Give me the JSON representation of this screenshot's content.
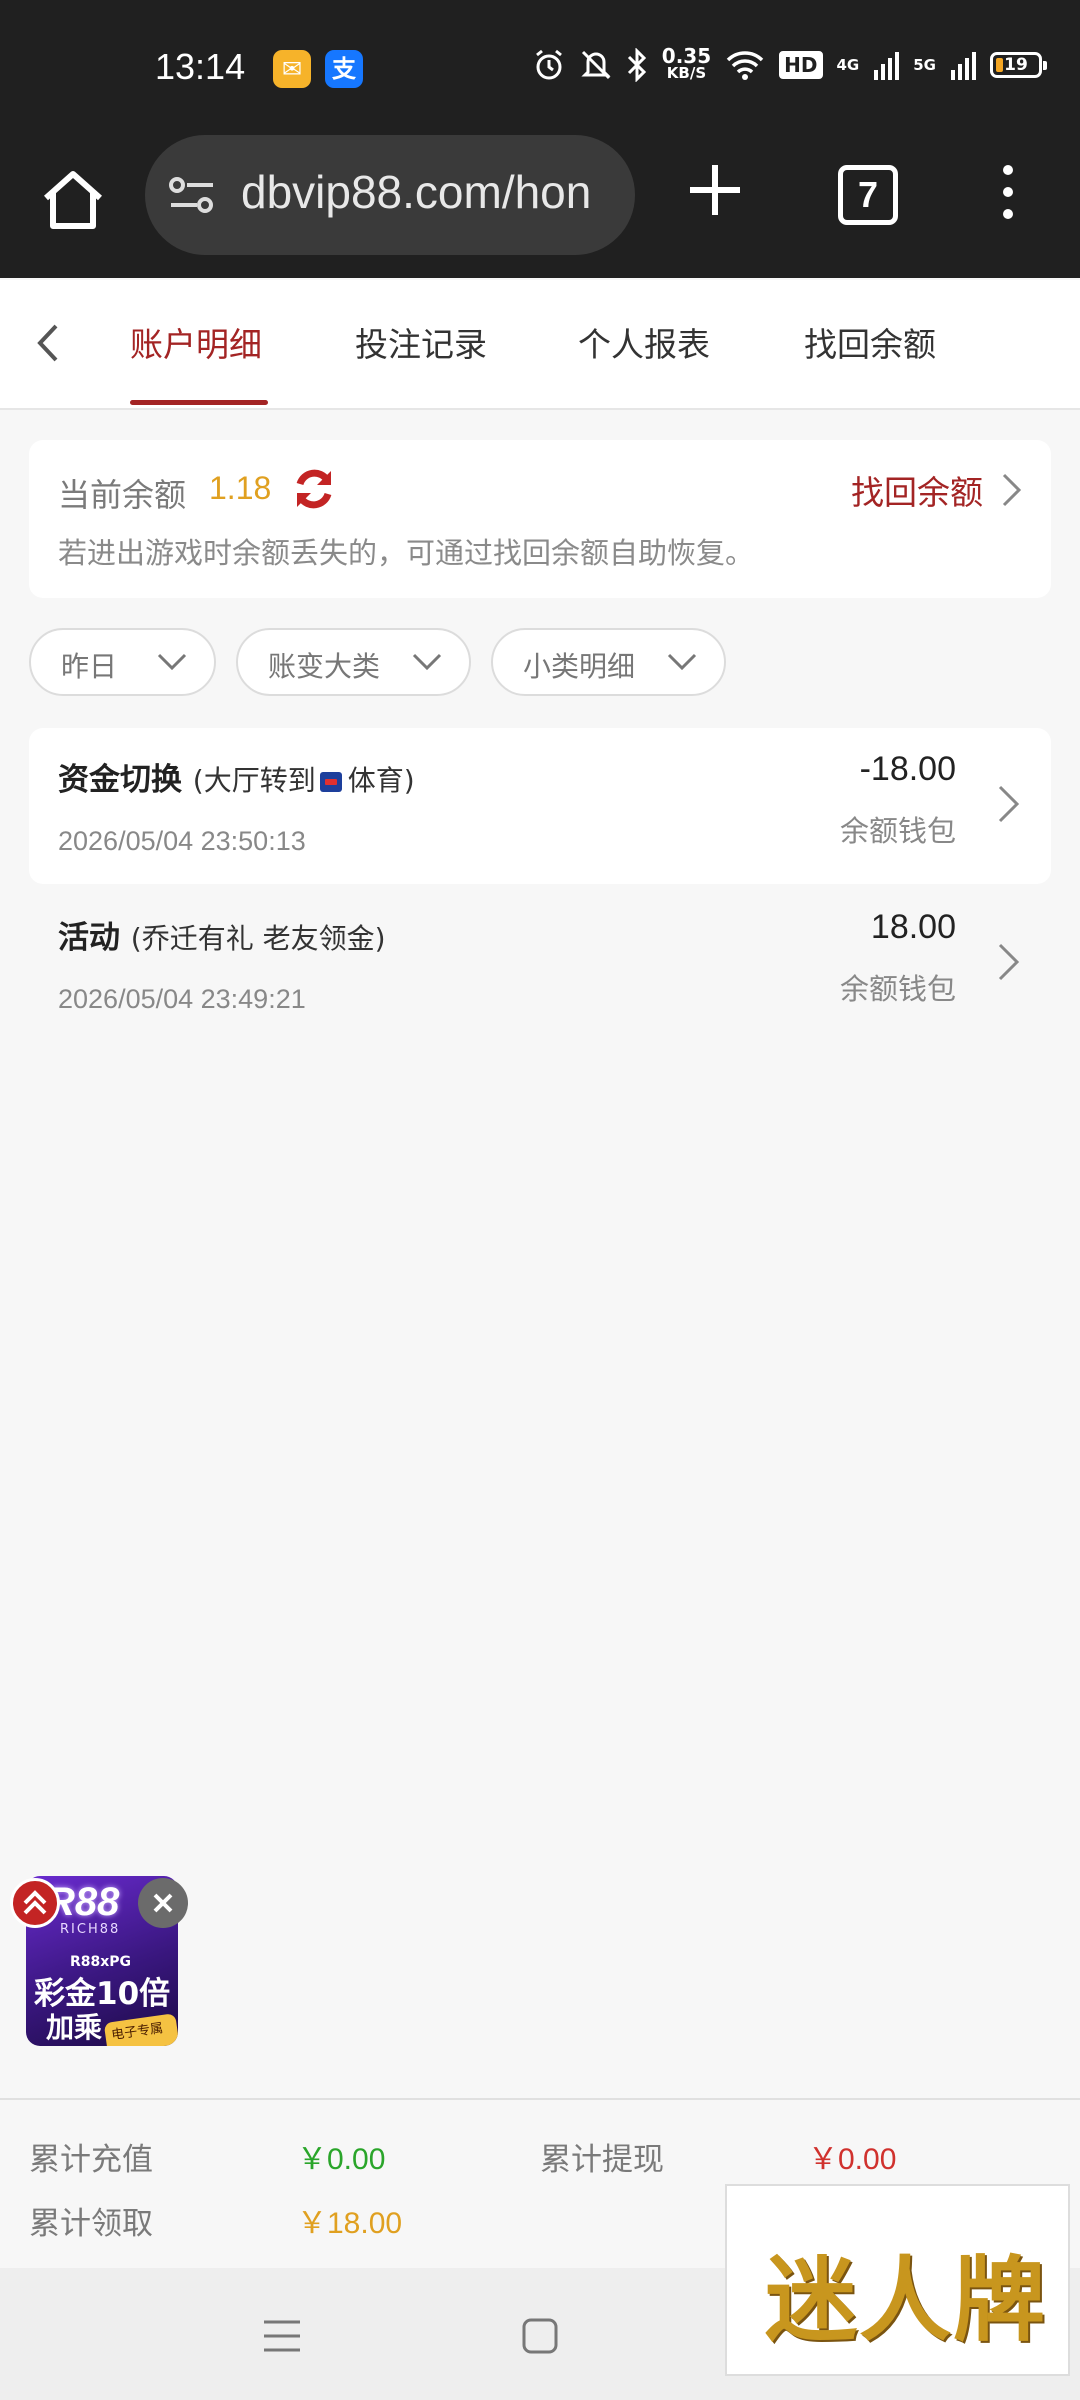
{
  "status_bar": {
    "time": "13:14",
    "net_speed_value": "0.35",
    "net_speed_unit": "KB/S",
    "hd_badge": "HD",
    "net_4g": "4G",
    "net_5g": "5G",
    "battery": "19",
    "app_icons": [
      "mail-app-icon",
      "alipay-app-icon"
    ],
    "icons": [
      "alarm-icon",
      "mute-icon",
      "bluetooth-icon",
      "wifi-icon",
      "signal-icon",
      "battery-icon"
    ]
  },
  "browser": {
    "url": "dbvip88.com/hon",
    "tab_count": "7"
  },
  "tabs": [
    {
      "label": "账户明细",
      "active": true
    },
    {
      "label": "投注记录",
      "active": false
    },
    {
      "label": "个人报表",
      "active": false
    },
    {
      "label": "找回余额",
      "active": false
    }
  ],
  "balance": {
    "label": "当前余额",
    "value": "1.18",
    "recover_label": "找回余额",
    "tip": "若进出游戏时余额丢失的，可通过找回余额自助恢复。"
  },
  "filters": [
    {
      "label": "昨日"
    },
    {
      "label": "账变大类"
    },
    {
      "label": "小类明细"
    }
  ],
  "records": [
    {
      "type": "资金切换",
      "detail_prefix": "(大厅转到",
      "detail_suffix": "体育)",
      "time": "2026/05/04 23:50:13",
      "amount": "-18.00",
      "wallet": "余额钱包"
    },
    {
      "type": "活动",
      "detail": "(乔迁有礼 老友领金)",
      "time": "2026/05/04 23:49:21",
      "amount": "18.00",
      "wallet": "余额钱包"
    }
  ],
  "promo": {
    "logo": "R88",
    "sub": "RICH88",
    "tag": "R88xPG",
    "line1": "彩金10倍",
    "line2": "加乘",
    "badge": "电子专属 >"
  },
  "summary": {
    "deposit_label": "累计充值",
    "deposit_value": "￥0.00",
    "withdraw_label": "累计提现",
    "withdraw_value": "￥0.00",
    "claim_label": "累计领取",
    "claim_value": "￥18.00",
    "colors": {
      "deposit": "#2aa52a",
      "withdraw": "#d0312d",
      "claim": "#e0a020"
    }
  },
  "watermark": "迷人牌",
  "colors": {
    "accent": "#a32424",
    "balance": "#e0a020"
  }
}
